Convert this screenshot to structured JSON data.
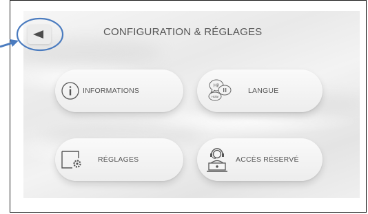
{
  "header": {
    "title": "CONFIGURATION & RÉGLAGES",
    "back_icon": "back-arrow-icon"
  },
  "tiles": [
    {
      "label": "INFORMATIONS",
      "icon": "info-icon"
    },
    {
      "label": "LANGUE",
      "icon": "speech-bubbles-icon"
    },
    {
      "label": "RÉGLAGES",
      "icon": "settings-screen-icon"
    },
    {
      "label": "ACCÈS RÉSERVÉ",
      "icon": "operator-icon"
    }
  ],
  "speech_bubble_text": {
    "top": "Hi!",
    "left": "Hola!"
  },
  "colors": {
    "annotation": "#4a7bbf",
    "title_text": "#555555",
    "frame_border": "#1a1a1a"
  }
}
